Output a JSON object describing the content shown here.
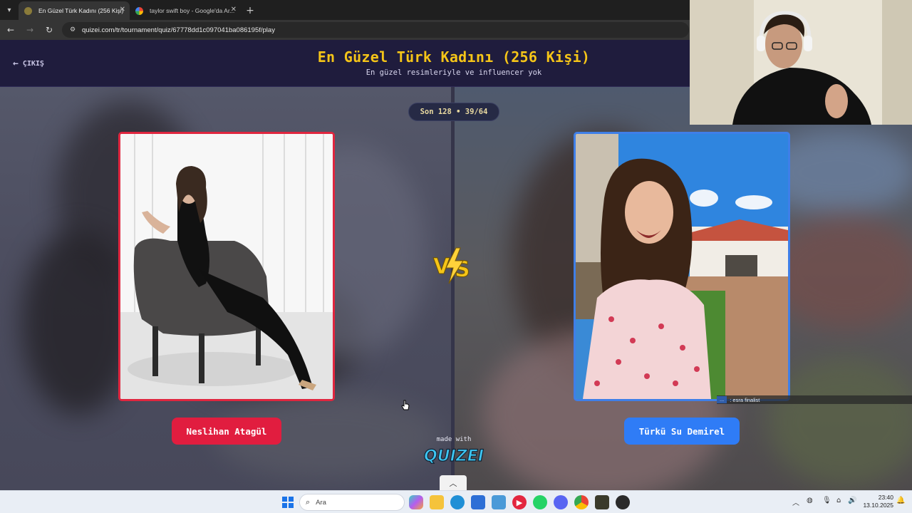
{
  "browser": {
    "tabs": [
      {
        "title": "En Güzel Türk Kadını (256 Kişi)",
        "active": true
      },
      {
        "title": "taylor swift boy - Google'da Ar...",
        "active": false
      }
    ],
    "url": "quizei.com/tr/tournament/quiz/67778dd1c097041ba086195f/play"
  },
  "header": {
    "exit_label": "ÇIKIŞ",
    "title": "En Güzel Türk Kadını (256 Kişi)",
    "subtitle": "En güzel resimleriyle ve influencer yok"
  },
  "match": {
    "round_label": "Son 128 • 39/64",
    "left": {
      "name": "Neslihan Atagül",
      "accent": "#e11d3f"
    },
    "right": {
      "name": "Türkü Su Demirel",
      "accent": "#2f7cf6"
    },
    "vs_icon": "vs-lightning-icon"
  },
  "footer": {
    "made_with": "made with",
    "brand": "QUIZEI"
  },
  "overlay_caption": {
    "tag": "...",
    "text": ": esra finalist"
  },
  "taskbar": {
    "search_placeholder": "Ara",
    "time": "23:40",
    "date": "13.10.2025"
  },
  "colors": {
    "header_bg": "#1f1c3d",
    "title": "#f5c518"
  }
}
